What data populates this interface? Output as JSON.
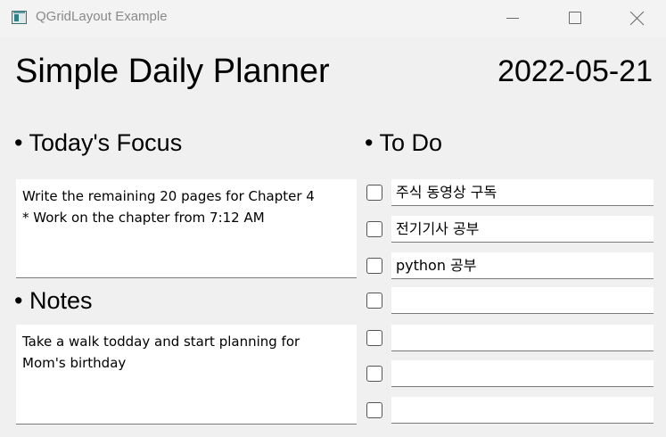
{
  "window": {
    "title": "QGridLayout Example",
    "icon": "qt-window-icon"
  },
  "header": {
    "title": "Simple Daily Planner",
    "date": "2022-05-21"
  },
  "sections": {
    "focus_heading": "• Today's Focus",
    "todo_heading": "• To Do",
    "notes_heading": "• Notes"
  },
  "focus": {
    "text": "Write the remaining 20 pages for Chapter 4\n* Work on the chapter from 7:12 AM"
  },
  "notes": {
    "text": "Take a walk todday and start planning for\nMom's birthday"
  },
  "todos": [
    {
      "checked": false,
      "text": "주식 동영상 구독"
    },
    {
      "checked": false,
      "text": "전기기사 공부"
    },
    {
      "checked": false,
      "text": "python 공부"
    },
    {
      "checked": false,
      "text": ""
    },
    {
      "checked": false,
      "text": ""
    },
    {
      "checked": false,
      "text": ""
    },
    {
      "checked": false,
      "text": ""
    }
  ]
}
